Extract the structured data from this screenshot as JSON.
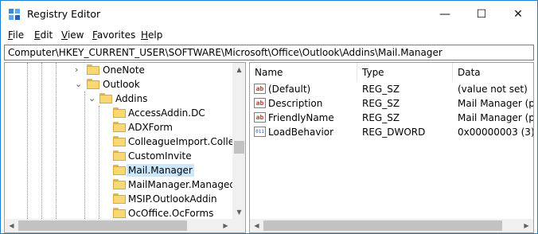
{
  "window": {
    "title": "Registry Editor",
    "icon": "registry-editor-icon",
    "controls": {
      "minimize": "—",
      "maximize": "☐",
      "close": "✕"
    }
  },
  "menu": [
    {
      "label": "File",
      "mnemonic": "F",
      "rest": "ile"
    },
    {
      "label": "Edit",
      "mnemonic": "E",
      "rest": "dit"
    },
    {
      "label": "View",
      "mnemonic": "V",
      "rest": "iew"
    },
    {
      "label": "Favorites",
      "mnemonic": "F",
      "rest": "avorites"
    },
    {
      "label": "Help",
      "mnemonic": "H",
      "rest": "elp"
    }
  ],
  "address": {
    "path": "Computer\\HKEY_CURRENT_USER\\SOFTWARE\\Microsoft\\Office\\Outlook\\Addins\\Mail.Manager"
  },
  "tree": {
    "items": [
      {
        "label": "OneNote",
        "expander": "›",
        "selected": false
      },
      {
        "label": "Outlook",
        "expander": "⌄",
        "selected": false
      },
      {
        "label": "Addins",
        "expander": "⌄",
        "selected": false
      },
      {
        "label": "AccessAddin.DC",
        "expander": "",
        "selected": false
      },
      {
        "label": "ADXForm",
        "expander": "",
        "selected": false
      },
      {
        "label": "ColleagueImport.Colleag",
        "expander": "",
        "selected": false
      },
      {
        "label": "CustomInvite",
        "expander": "",
        "selected": false
      },
      {
        "label": "Mail.Manager",
        "expander": "",
        "selected": true
      },
      {
        "label": "MailManager.Managed",
        "expander": "",
        "selected": false
      },
      {
        "label": "MSIP.OutlookAddin",
        "expander": "",
        "selected": false
      },
      {
        "label": "OcOffice.OcForms",
        "expander": "",
        "selected": false
      }
    ]
  },
  "list": {
    "columns": [
      "Name",
      "Type",
      "Data"
    ],
    "rows": [
      {
        "name": "(Default)",
        "type": "REG_SZ",
        "data": "(value not set)",
        "icon": "ab"
      },
      {
        "name": "Description",
        "type": "REG_SZ",
        "data": "Mail Manager (per",
        "icon": "ab"
      },
      {
        "name": "FriendlyName",
        "type": "REG_SZ",
        "data": "Mail Manager (per",
        "icon": "ab"
      },
      {
        "name": "LoadBehavior",
        "type": "REG_DWORD",
        "data": "0x00000003 (3)",
        "icon": "011"
      }
    ]
  },
  "scroll": {
    "up": "▲",
    "down": "▼",
    "left": "◀",
    "right": "▶"
  },
  "colors": {
    "selection": "#cce8ff",
    "border": "#1a7fd0",
    "folder": "#f8d775"
  }
}
